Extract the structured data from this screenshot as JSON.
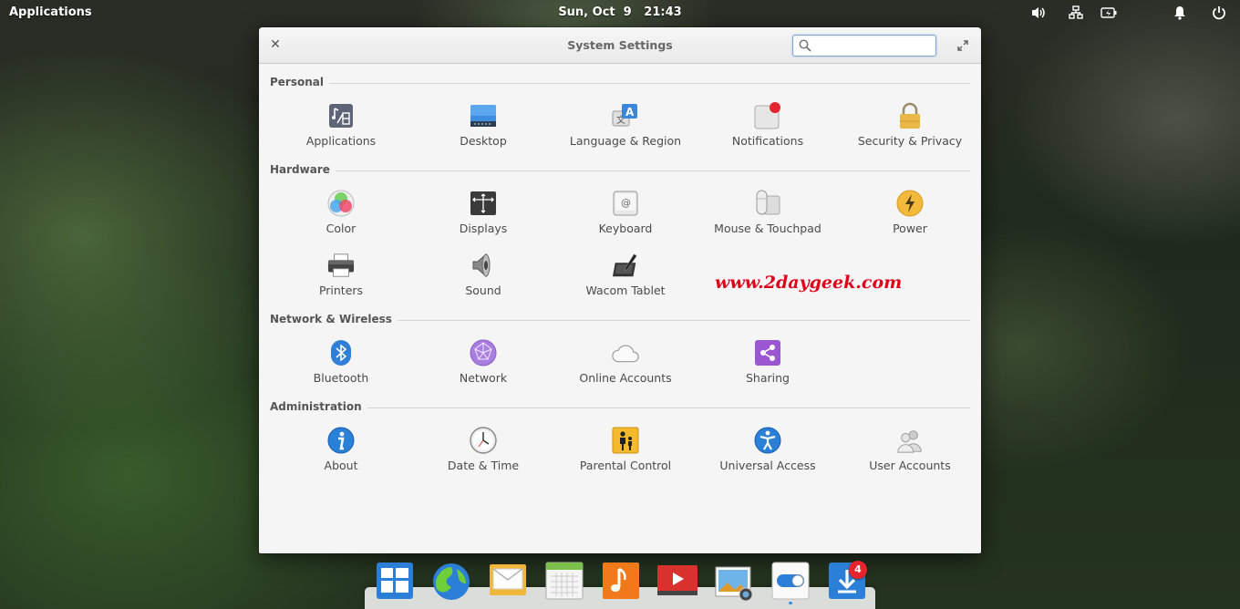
{
  "panel": {
    "applications_label": "Applications",
    "datetime": "Sun, Oct  9   21:43",
    "indicators": [
      "volume-icon",
      "network-icon",
      "battery-icon",
      "notifications-icon",
      "power-icon"
    ]
  },
  "window": {
    "title": "System Settings",
    "search": {
      "value": "",
      "placeholder": ""
    }
  },
  "sections": [
    {
      "name": "Personal",
      "items": [
        {
          "label": "Applications",
          "icon": "applications-icon"
        },
        {
          "label": "Desktop",
          "icon": "desktop-icon"
        },
        {
          "label": "Language & Region",
          "icon": "language-region-icon"
        },
        {
          "label": "Notifications",
          "icon": "notifications-icon"
        },
        {
          "label": "Security & Privacy",
          "icon": "security-privacy-icon"
        }
      ]
    },
    {
      "name": "Hardware",
      "items": [
        {
          "label": "Color",
          "icon": "color-icon"
        },
        {
          "label": "Displays",
          "icon": "displays-icon"
        },
        {
          "label": "Keyboard",
          "icon": "keyboard-icon"
        },
        {
          "label": "Mouse & Touchpad",
          "icon": "mouse-touchpad-icon"
        },
        {
          "label": "Power",
          "icon": "power-icon"
        },
        {
          "label": "Printers",
          "icon": "printers-icon"
        },
        {
          "label": "Sound",
          "icon": "sound-icon"
        },
        {
          "label": "Wacom Tablet",
          "icon": "wacom-tablet-icon"
        }
      ]
    },
    {
      "name": "Network & Wireless",
      "items": [
        {
          "label": "Bluetooth",
          "icon": "bluetooth-icon"
        },
        {
          "label": "Network",
          "icon": "network-icon"
        },
        {
          "label": "Online Accounts",
          "icon": "online-accounts-icon"
        },
        {
          "label": "Sharing",
          "icon": "sharing-icon"
        }
      ]
    },
    {
      "name": "Administration",
      "items": [
        {
          "label": "About",
          "icon": "about-icon"
        },
        {
          "label": "Date & Time",
          "icon": "date-time-icon"
        },
        {
          "label": "Parental Control",
          "icon": "parental-control-icon"
        },
        {
          "label": "Universal Access",
          "icon": "universal-access-icon"
        },
        {
          "label": "User Accounts",
          "icon": "user-accounts-icon"
        }
      ]
    }
  ],
  "watermark": "www.2daygeek.com",
  "dock": {
    "items": [
      {
        "icon": "multitasking-view-icon"
      },
      {
        "icon": "web-browser-icon"
      },
      {
        "icon": "mail-icon"
      },
      {
        "icon": "calendar-icon"
      },
      {
        "icon": "music-icon"
      },
      {
        "icon": "videos-icon"
      },
      {
        "icon": "photos-icon"
      },
      {
        "icon": "system-settings-icon",
        "running": true
      },
      {
        "icon": "appcenter-icon",
        "badge": "4"
      }
    ]
  }
}
